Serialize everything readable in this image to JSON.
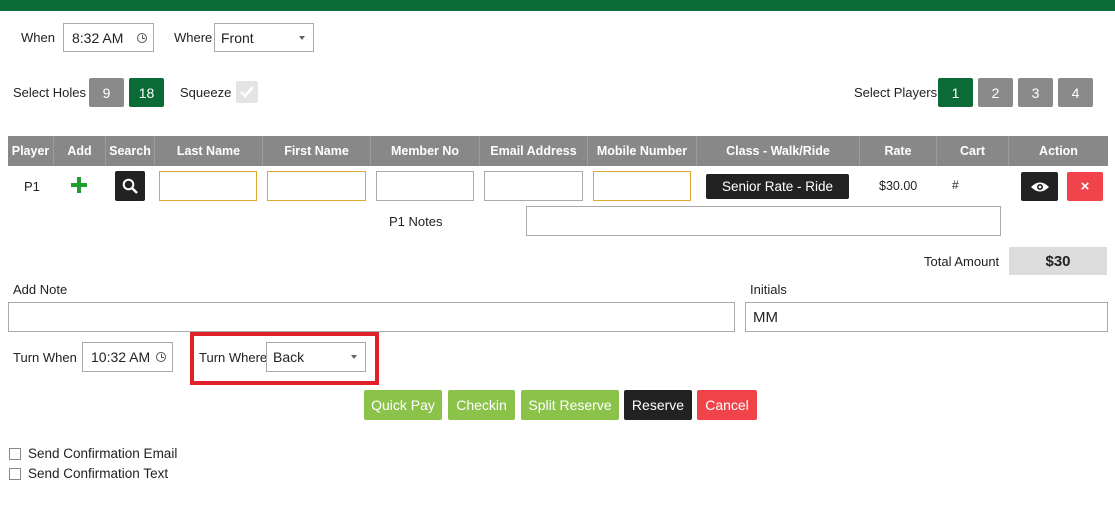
{
  "when": {
    "label": "When",
    "time": "8:32 AM"
  },
  "where": {
    "label": "Where",
    "value": "Front"
  },
  "holes": {
    "label": "Select Holes",
    "options": [
      "9",
      "18"
    ]
  },
  "squeeze": {
    "label": "Squeeze"
  },
  "players": {
    "label": "Select Players",
    "options": [
      "1",
      "2",
      "3",
      "4"
    ]
  },
  "table": {
    "headers": [
      "Player",
      "Add",
      "Search",
      "Last Name",
      "First Name",
      "Member No",
      "Email Address",
      "Mobile Number",
      "Class - Walk/Ride",
      "Rate",
      "Cart",
      "Action"
    ],
    "row": {
      "player": "P1",
      "class": "Senior Rate - Ride",
      "rate": "$30.00",
      "cart": "#",
      "delete": "×"
    },
    "notes_label": "P1 Notes"
  },
  "total": {
    "label": "Total Amount",
    "value": "$30"
  },
  "add_note": {
    "label": "Add Note"
  },
  "initials": {
    "label": "Initials",
    "value": "MM"
  },
  "turn_when": {
    "label": "Turn When",
    "time": "10:32 AM"
  },
  "turn_where": {
    "label": "Turn Where",
    "value": "Back"
  },
  "actions": {
    "quick_pay": "Quick Pay",
    "checkin": "Checkin",
    "split_reserve": "Split Reserve",
    "reserve": "Reserve",
    "cancel": "Cancel"
  },
  "confirm": {
    "email": "Send Confirmation Email",
    "text": "Send Confirmation Text"
  },
  "colors": {
    "brand": "#0b6b37",
    "accent_green": "#8bc34a",
    "danger": "#f0444a",
    "highlight": "#e0202a"
  }
}
